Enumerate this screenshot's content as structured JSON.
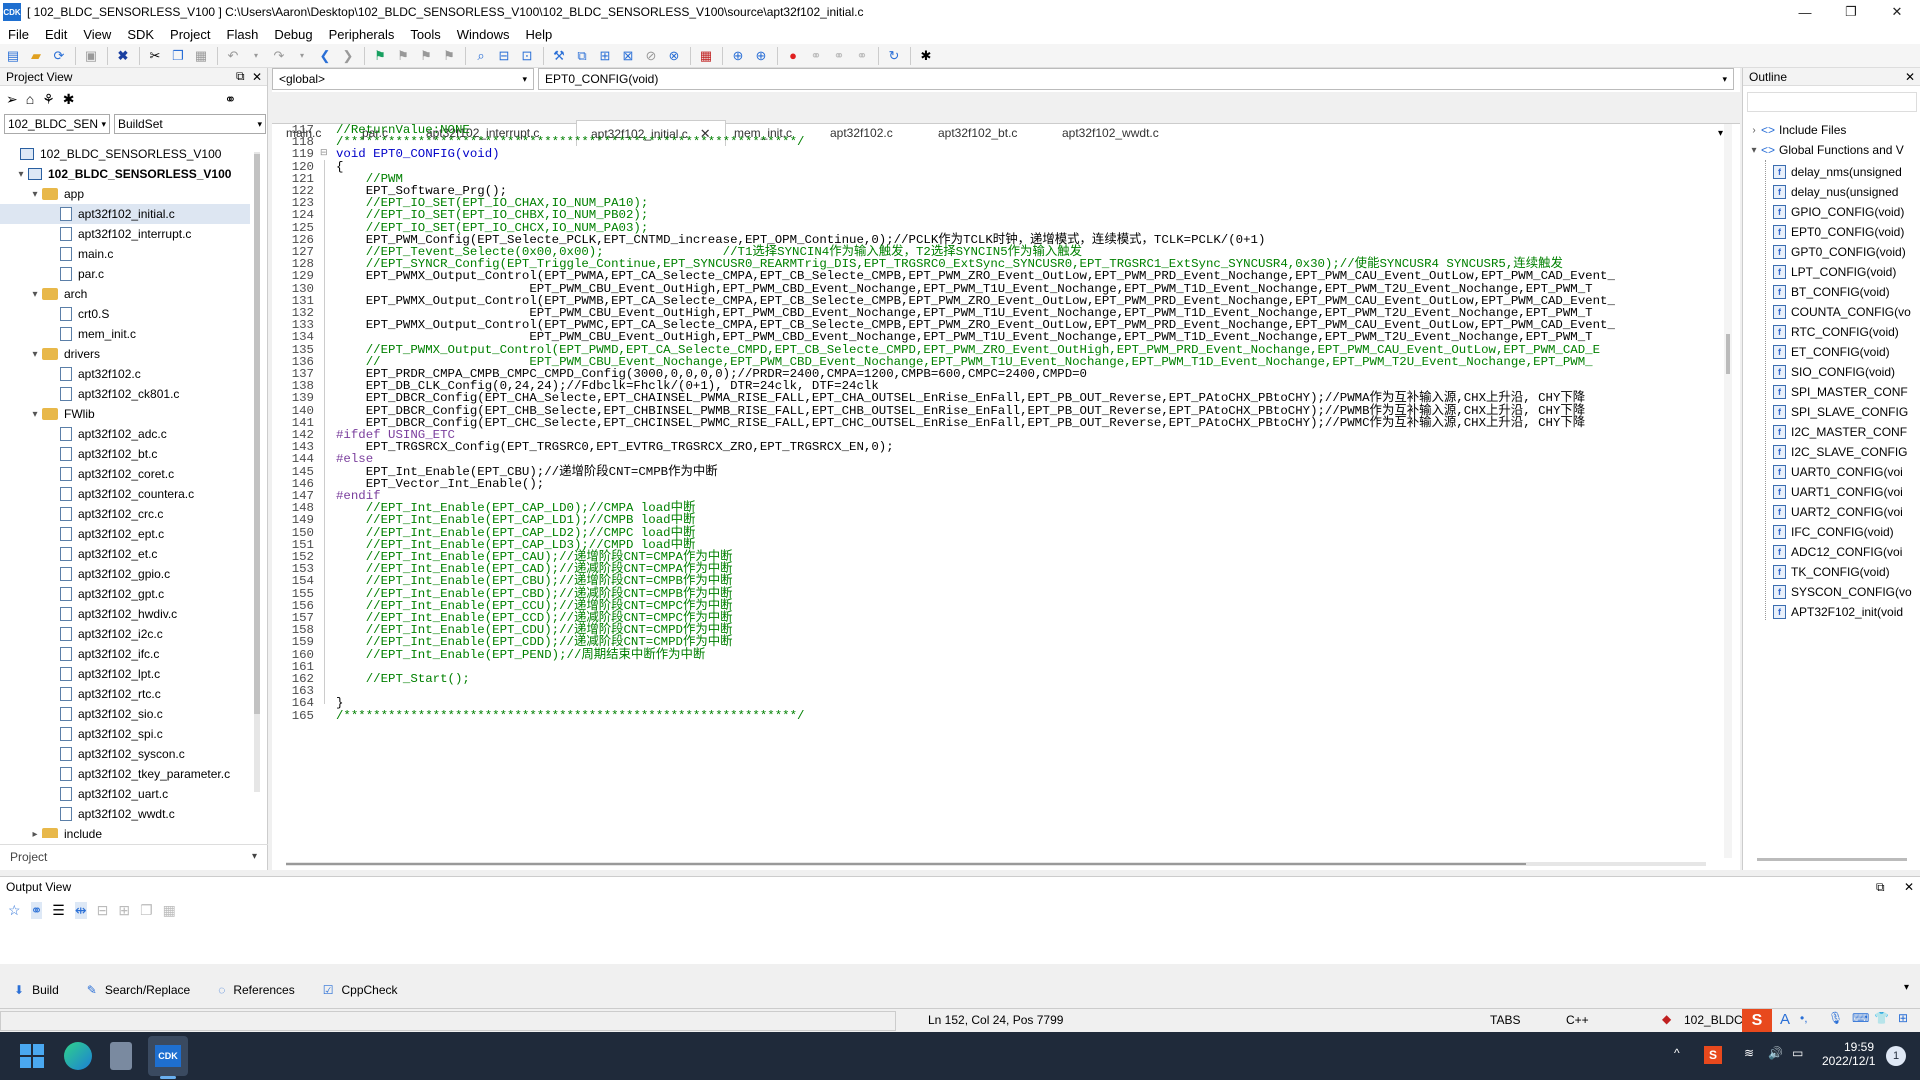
{
  "window": {
    "title": "[ 102_BLDC_SENSORLESS_V100 ] C:\\Users\\Aaron\\Desktop\\102_BLDC_SENSORLESS_V100\\102_BLDC_SENSORLESS_V100\\source\\apt32f102_initial.c",
    "app_icon": "CDK"
  },
  "menu": [
    "File",
    "Edit",
    "View",
    "SDK",
    "Project",
    "Flash",
    "Debug",
    "Peripherals",
    "Tools",
    "Windows",
    "Help"
  ],
  "project_view": {
    "header": "Project View",
    "project_select": "102_BLDC_SEN",
    "buildset": "BuildSet",
    "footer": "Project",
    "tree": [
      {
        "level": 0,
        "type": "workspace",
        "label": "102_BLDC_SENSORLESS_V100",
        "exp": ""
      },
      {
        "level": 1,
        "type": "project",
        "label": "102_BLDC_SENSORLESS_V100",
        "exp": "▾"
      },
      {
        "level": 2,
        "type": "folder",
        "label": "app",
        "exp": "▾"
      },
      {
        "level": 3,
        "type": "file",
        "label": "apt32f102_initial.c",
        "exp": ""
      },
      {
        "level": 3,
        "type": "file",
        "label": "apt32f102_interrupt.c",
        "exp": ""
      },
      {
        "level": 3,
        "type": "file",
        "label": "main.c",
        "exp": ""
      },
      {
        "level": 3,
        "type": "file",
        "label": "par.c",
        "exp": ""
      },
      {
        "level": 2,
        "type": "folder",
        "label": "arch",
        "exp": "▾"
      },
      {
        "level": 3,
        "type": "file",
        "label": "crt0.S",
        "exp": ""
      },
      {
        "level": 3,
        "type": "file",
        "label": "mem_init.c",
        "exp": ""
      },
      {
        "level": 2,
        "type": "folder",
        "label": "drivers",
        "exp": "▾"
      },
      {
        "level": 3,
        "type": "file",
        "label": "apt32f102.c",
        "exp": ""
      },
      {
        "level": 3,
        "type": "file",
        "label": "apt32f102_ck801.c",
        "exp": ""
      },
      {
        "level": 2,
        "type": "folder",
        "label": "FWlib",
        "exp": "▾"
      },
      {
        "level": 3,
        "type": "file",
        "label": "apt32f102_adc.c",
        "exp": ""
      },
      {
        "level": 3,
        "type": "file",
        "label": "apt32f102_bt.c",
        "exp": ""
      },
      {
        "level": 3,
        "type": "file",
        "label": "apt32f102_coret.c",
        "exp": ""
      },
      {
        "level": 3,
        "type": "file",
        "label": "apt32f102_countera.c",
        "exp": ""
      },
      {
        "level": 3,
        "type": "file",
        "label": "apt32f102_crc.c",
        "exp": ""
      },
      {
        "level": 3,
        "type": "file",
        "label": "apt32f102_ept.c",
        "exp": ""
      },
      {
        "level": 3,
        "type": "file",
        "label": "apt32f102_et.c",
        "exp": ""
      },
      {
        "level": 3,
        "type": "file",
        "label": "apt32f102_gpio.c",
        "exp": ""
      },
      {
        "level": 3,
        "type": "file",
        "label": "apt32f102_gpt.c",
        "exp": ""
      },
      {
        "level": 3,
        "type": "file",
        "label": "apt32f102_hwdiv.c",
        "exp": ""
      },
      {
        "level": 3,
        "type": "file",
        "label": "apt32f102_i2c.c",
        "exp": ""
      },
      {
        "level": 3,
        "type": "file",
        "label": "apt32f102_ifc.c",
        "exp": ""
      },
      {
        "level": 3,
        "type": "file",
        "label": "apt32f102_lpt.c",
        "exp": ""
      },
      {
        "level": 3,
        "type": "file",
        "label": "apt32f102_rtc.c",
        "exp": ""
      },
      {
        "level": 3,
        "type": "file",
        "label": "apt32f102_sio.c",
        "exp": ""
      },
      {
        "level": 3,
        "type": "file",
        "label": "apt32f102_spi.c",
        "exp": ""
      },
      {
        "level": 3,
        "type": "file",
        "label": "apt32f102_syscon.c",
        "exp": ""
      },
      {
        "level": 3,
        "type": "file",
        "label": "apt32f102_tkey_parameter.c",
        "exp": ""
      },
      {
        "level": 3,
        "type": "file",
        "label": "apt32f102_uart.c",
        "exp": ""
      },
      {
        "level": 3,
        "type": "file",
        "label": "apt32f102_wwdt.c",
        "exp": ""
      },
      {
        "level": 2,
        "type": "folder",
        "label": "include",
        "exp": "▸"
      }
    ]
  },
  "editor": {
    "scope": "<global>",
    "function": "EPT0_CONFIG(void)",
    "tabs": [
      "main.c",
      "par.c",
      "apt32f102_interrupt.c",
      "apt32f102_initial.c",
      "mem_init.c",
      "apt32f102.c",
      "apt32f102_bt.c",
      "apt32f102_wwdt.c"
    ],
    "active_tab": "apt32f102_initial.c",
    "lines": [
      {
        "n": "117",
        "t": "//ReturnValue:NONE",
        "c": "cm"
      },
      {
        "n": "118",
        "t": "/*************************************************************/",
        "c": "cm"
      },
      {
        "n": "119",
        "t": "void EPT0_CONFIG(void)",
        "c": "fn"
      },
      {
        "n": "120",
        "t": "{",
        "c": ""
      },
      {
        "n": "121",
        "t": "    //PWM",
        "c": "cm"
      },
      {
        "n": "122",
        "t": "    EPT_Software_Prg();",
        "c": ""
      },
      {
        "n": "123",
        "t": "    //EPT_IO_SET(EPT_IO_CHAX,IO_NUM_PA10);",
        "c": "cm"
      },
      {
        "n": "124",
        "t": "    //EPT_IO_SET(EPT_IO_CHBX,IO_NUM_PB02);",
        "c": "cm"
      },
      {
        "n": "125",
        "t": "    //EPT_IO_SET(EPT_IO_CHCX,IO_NUM_PA03);",
        "c": "cm"
      },
      {
        "n": "126",
        "t": "    EPT_PWM_Config(EPT_Selecte_PCLK,EPT_CNTMD_increase,EPT_OPM_Continue,0);//PCLK作为TCLK时钟，递增模式，连续模式，TCLK=PCLK/(0+1)",
        "c": "mix"
      },
      {
        "n": "127",
        "t": "    //EPT_Tevent_Selecte(0x00,0x00);                //T1选择SYNCIN4作为输入触发，T2选择SYNCIN5作为输入触发",
        "c": "cm"
      },
      {
        "n": "128",
        "t": "    //EPT_SYNCR_Config(EPT_Triggle_Continue,EPT_SYNCUSR0_REARMTrig_DIS,EPT_TRGSRC0_ExtSync_SYNCUSR0,EPT_TRGSRC1_ExtSync_SYNCUSR4,0x30);//使能SYNCUSR4 SYNCUSR5,连续触发",
        "c": "cm"
      },
      {
        "n": "129",
        "t": "    EPT_PWMX_Output_Control(EPT_PWMA,EPT_CA_Selecte_CMPA,EPT_CB_Selecte_CMPB,EPT_PWM_ZRO_Event_OutLow,EPT_PWM_PRD_Event_Nochange,EPT_PWM_CAU_Event_OutLow,EPT_PWM_CAD_Event_",
        "c": ""
      },
      {
        "n": "130",
        "t": "                          EPT_PWM_CBU_Event_OutHigh,EPT_PWM_CBD_Event_Nochange,EPT_PWM_T1U_Event_Nochange,EPT_PWM_T1D_Event_Nochange,EPT_PWM_T2U_Event_Nochange,EPT_PWM_T",
        "c": ""
      },
      {
        "n": "131",
        "t": "    EPT_PWMX_Output_Control(EPT_PWMB,EPT_CA_Selecte_CMPA,EPT_CB_Selecte_CMPB,EPT_PWM_ZRO_Event_OutLow,EPT_PWM_PRD_Event_Nochange,EPT_PWM_CAU_Event_OutLow,EPT_PWM_CAD_Event_",
        "c": ""
      },
      {
        "n": "132",
        "t": "                          EPT_PWM_CBU_Event_OutHigh,EPT_PWM_CBD_Event_Nochange,EPT_PWM_T1U_Event_Nochange,EPT_PWM_T1D_Event_Nochange,EPT_PWM_T2U_Event_Nochange,EPT_PWM_T",
        "c": ""
      },
      {
        "n": "133",
        "t": "    EPT_PWMX_Output_Control(EPT_PWMC,EPT_CA_Selecte_CMPA,EPT_CB_Selecte_CMPB,EPT_PWM_ZRO_Event_OutLow,EPT_PWM_PRD_Event_Nochange,EPT_PWM_CAU_Event_OutLow,EPT_PWM_CAD_Event_",
        "c": ""
      },
      {
        "n": "134",
        "t": "                          EPT_PWM_CBU_Event_OutHigh,EPT_PWM_CBD_Event_Nochange,EPT_PWM_T1U_Event_Nochange,EPT_PWM_T1D_Event_Nochange,EPT_PWM_T2U_Event_Nochange,EPT_PWM_T",
        "c": ""
      },
      {
        "n": "135",
        "t": "    //EPT_PWMX_Output_Control(EPT_PWMD,EPT_CA_Selecte_CMPD,EPT_CB_Selecte_CMPD,EPT_PWM_ZRO_Event_OutHigh,EPT_PWM_PRD_Event_Nochange,EPT_PWM_CAU_Event_OutLow,EPT_PWM_CAD_E",
        "c": "cm"
      },
      {
        "n": "136",
        "t": "    //                    EPT_PWM_CBU_Event_Nochange,EPT_PWM_CBD_Event_Nochange,EPT_PWM_T1U_Event_Nochange,EPT_PWM_T1D_Event_Nochange,EPT_PWM_T2U_Event_Nochange,EPT_PWM_",
        "c": "cm"
      },
      {
        "n": "137",
        "t": "    EPT_PRDR_CMPA_CMPB_CMPC_CMPD_Config(3000,0,0,0,0);//PRDR=2400,CMPA=1200,CMPB=600,CMPC=2400,CMPD=0",
        "c": "mix"
      },
      {
        "n": "138",
        "t": "    EPT_DB_CLK_Config(0,24,24);//Fdbclk=Fhclk/(0+1), DTR=24clk, DTF=24clk",
        "c": "mix"
      },
      {
        "n": "139",
        "t": "    EPT_DBCR_Config(EPT_CHA_Selecte,EPT_CHAINSEL_PWMA_RISE_FALL,EPT_CHA_OUTSEL_EnRise_EnFall,EPT_PB_OUT_Reverse,EPT_PAtoCHX_PBtoCHY);//PWMA作为互补输入源,CHX上升沿, CHY下降",
        "c": "mix"
      },
      {
        "n": "140",
        "t": "    EPT_DBCR_Config(EPT_CHB_Selecte,EPT_CHBINSEL_PWMB_RISE_FALL,EPT_CHB_OUTSEL_EnRise_EnFall,EPT_PB_OUT_Reverse,EPT_PAtoCHX_PBtoCHY);//PWMB作为互补输入源,CHX上升沿, CHY下降",
        "c": "mix"
      },
      {
        "n": "141",
        "t": "    EPT_DBCR_Config(EPT_CHC_Selecte,EPT_CHCINSEL_PWMC_RISE_FALL,EPT_CHC_OUTSEL_EnRise_EnFall,EPT_PB_OUT_Reverse,EPT_PAtoCHX_PBtoCHY);//PWMC作为互补输入源,CHX上升沿, CHY下降",
        "c": "mix"
      },
      {
        "n": "142",
        "t": "#ifdef USING_ETC",
        "c": "pp"
      },
      {
        "n": "143",
        "t": "    EPT_TRGSRCX_Config(EPT_TRGSRC0,EPT_EVTRG_TRGSRCX_ZRO,EPT_TRGSRCX_EN,0);",
        "c": ""
      },
      {
        "n": "144",
        "t": "#else",
        "c": "pp"
      },
      {
        "n": "145",
        "t": "    EPT_Int_Enable(EPT_CBU);//递增阶段CNT=CMPB作为中断",
        "c": "mix"
      },
      {
        "n": "146",
        "t": "    EPT_Vector_Int_Enable();",
        "c": ""
      },
      {
        "n": "147",
        "t": "#endif",
        "c": "pp"
      },
      {
        "n": "148",
        "t": "    //EPT_Int_Enable(EPT_CAP_LD0);//CMPA load中断",
        "c": "cm"
      },
      {
        "n": "149",
        "t": "    //EPT_Int_Enable(EPT_CAP_LD1);//CMPB load中断",
        "c": "cm"
      },
      {
        "n": "150",
        "t": "    //EPT_Int_Enable(EPT_CAP_LD2);//CMPC load中断",
        "c": "cm"
      },
      {
        "n": "151",
        "t": "    //EPT_Int_Enable(EPT_CAP_LD3);//CMPD load中断",
        "c": "cm"
      },
      {
        "n": "152",
        "t": "    //EPT_Int_Enable(EPT_CAU);//递增阶段CNT=CMPA作为中断",
        "c": "cm"
      },
      {
        "n": "153",
        "t": "    //EPT_Int_Enable(EPT_CAD);//递减阶段CNT=CMPA作为中断",
        "c": "cm"
      },
      {
        "n": "154",
        "t": "    //EPT_Int_Enable(EPT_CBU);//递增阶段CNT=CMPB作为中断",
        "c": "cm"
      },
      {
        "n": "155",
        "t": "    //EPT_Int_Enable(EPT_CBD);//递减阶段CNT=CMPB作为中断",
        "c": "cm"
      },
      {
        "n": "156",
        "t": "    //EPT_Int_Enable(EPT_CCU);//递增阶段CNT=CMPC作为中断",
        "c": "cm"
      },
      {
        "n": "157",
        "t": "    //EPT_Int_Enable(EPT_CCD);//递减阶段CNT=CMPC作为中断",
        "c": "cm"
      },
      {
        "n": "158",
        "t": "    //EPT_Int_Enable(EPT_CDU);//递增阶段CNT=CMPD作为中断",
        "c": "cm"
      },
      {
        "n": "159",
        "t": "    //EPT_Int_Enable(EPT_CDD);//递减阶段CNT=CMPD作为中断",
        "c": "cm"
      },
      {
        "n": "160",
        "t": "    //EPT_Int_Enable(EPT_PEND);//周期结束中断作为中断",
        "c": "cm"
      },
      {
        "n": "161",
        "t": "",
        "c": ""
      },
      {
        "n": "162",
        "t": "    //EPT_Start();",
        "c": "cm"
      },
      {
        "n": "163",
        "t": "",
        "c": ""
      },
      {
        "n": "164",
        "t": "}",
        "c": ""
      },
      {
        "n": "165",
        "t": "/*************************************************************/",
        "c": "cm"
      }
    ]
  },
  "outline": {
    "header": "Outline",
    "groups": [
      "Include Files",
      "Global Functions and V"
    ],
    "items": [
      "delay_nms(unsigned",
      "delay_nus(unsigned",
      "GPIO_CONFIG(void)",
      "EPT0_CONFIG(void)",
      "GPT0_CONFIG(void)",
      "LPT_CONFIG(void)",
      "BT_CONFIG(void)",
      "COUNTA_CONFIG(vo",
      "RTC_CONFIG(void)",
      "ET_CONFIG(void)",
      "SIO_CONFIG(void)",
      "SPI_MASTER_CONF",
      "SPI_SLAVE_CONFIG",
      "I2C_MASTER_CONF",
      "I2C_SLAVE_CONFIG",
      "UART0_CONFIG(voi",
      "UART1_CONFIG(voi",
      "UART2_CONFIG(voi",
      "IFC_CONFIG(void)",
      "ADC12_CONFIG(voi",
      "TK_CONFIG(void)",
      "SYSCON_CONFIG(vo",
      "APT32F102_init(void"
    ]
  },
  "output": {
    "header": "Output View"
  },
  "bottom_tabs": [
    "Build",
    "Search/Replace",
    "References",
    "CppCheck"
  ],
  "status": {
    "position": "Ln 152, Col 24, Pos 7799",
    "indent": "TABS",
    "lang": "C++",
    "project": "102_BLDC"
  },
  "taskbar": {
    "time": "19:59",
    "date": "2022/12/1"
  }
}
